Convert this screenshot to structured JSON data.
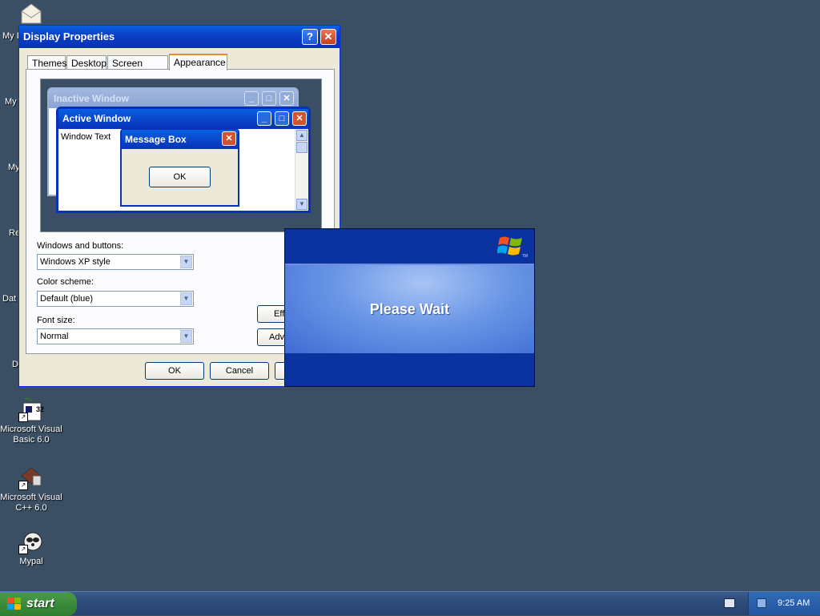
{
  "desktop": {
    "partial_labels": [
      "My I",
      "My",
      "My",
      "Re",
      "Dat",
      "D"
    ],
    "icons": [
      {
        "label": "Microsoft Visual Basic 6.0",
        "badge": "32"
      },
      {
        "label": "Microsoft Visual C++ 6.0"
      },
      {
        "label": "Mypal"
      }
    ]
  },
  "display_properties": {
    "title": "Display Properties",
    "help_glyph": "?",
    "close_glyph": "✕",
    "tabs": [
      "Themes",
      "Desktop",
      "Screen Saver",
      "Appearance"
    ],
    "active_tab": "Appearance",
    "preview": {
      "inactive_title": "Inactive Window",
      "active_title": "Active Window",
      "window_text": "Window Text",
      "message_box_title": "Message Box",
      "ok_label": "OK"
    },
    "fields": {
      "windows_buttons_label": "Windows and buttons:",
      "windows_buttons_value": "Windows XP style",
      "color_scheme_label": "Color scheme:",
      "color_scheme_value": "Default (blue)",
      "font_size_label": "Font size:",
      "font_size_value": "Normal"
    },
    "effects_button": "Eff",
    "advanced_button": "Adv",
    "ok_button": "OK",
    "cancel_button": "Cancel"
  },
  "splash": {
    "message": "Please Wait",
    "tm": "TM"
  },
  "taskbar": {
    "start_label": "start",
    "clock": "9:25 AM"
  },
  "colors": {
    "desktop": "#3a4e64",
    "title_blue": "#0831b8",
    "start_green": "#2f7d2f"
  }
}
